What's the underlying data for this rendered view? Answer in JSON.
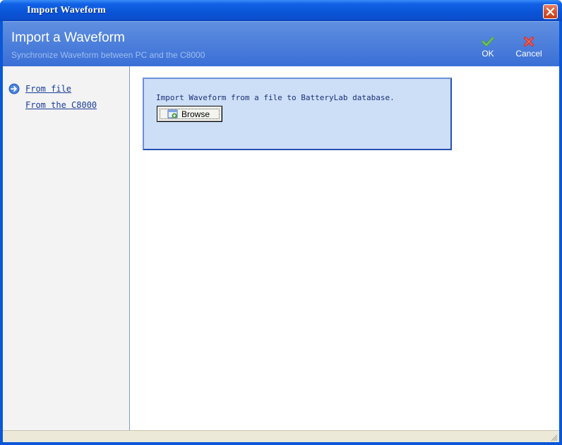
{
  "window": {
    "title": "Import Waveform"
  },
  "header": {
    "title": "Import a Waveform",
    "subtitle": "Synchronize Waveform between PC and the C8000",
    "ok_label": "OK",
    "cancel_label": "Cancel"
  },
  "sidebar": {
    "items": [
      {
        "label": "From file",
        "icon": "arrow-right-circle-icon"
      },
      {
        "label": "From the C8000"
      }
    ]
  },
  "import_panel": {
    "description": "Import Waveform from a file to BatteryLab database.",
    "browse_label": "Browse"
  },
  "colors": {
    "title_bar": "#0a55d8",
    "header": "#3a6fd6",
    "panel_background": "#cddff7",
    "panel_border": "#2a4fb0",
    "link": "#1a3d9a",
    "ok_check": "#4fa52a",
    "cancel_x": "#d8322a"
  }
}
